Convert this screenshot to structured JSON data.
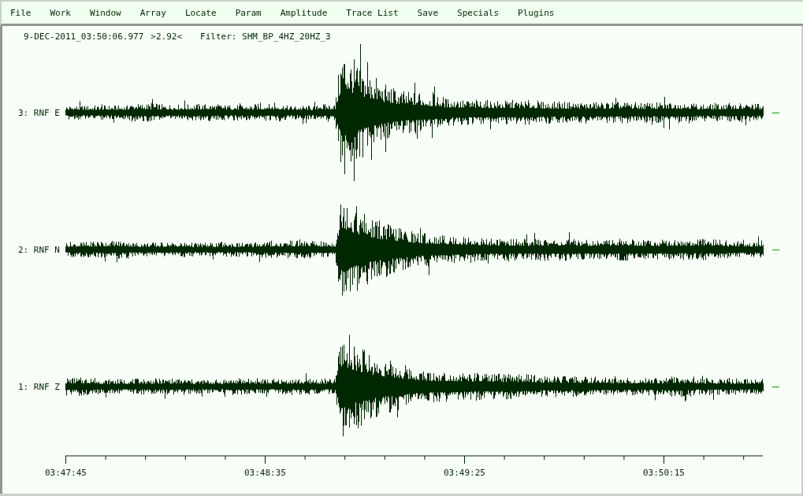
{
  "menu": [
    "File",
    "Work",
    "Window",
    "Array",
    "Locate",
    "Param",
    "Amplitude",
    "Trace List",
    "Save",
    "Specials",
    "Plugins"
  ],
  "header": {
    "time": "9-DEC-2011_03:50:06.977",
    "scale": ">2.92<",
    "filter": "Filter: SHM_BP_4HZ_20HZ_3"
  },
  "traces": [
    {
      "label": "3: RNF E"
    },
    {
      "label": "2: RNF N"
    },
    {
      "label": "1: RNF Z"
    }
  ],
  "time_axis": {
    "labels": [
      "03:47:45",
      "03:48:35",
      "03:49:25",
      "03:50:15"
    ]
  }
}
